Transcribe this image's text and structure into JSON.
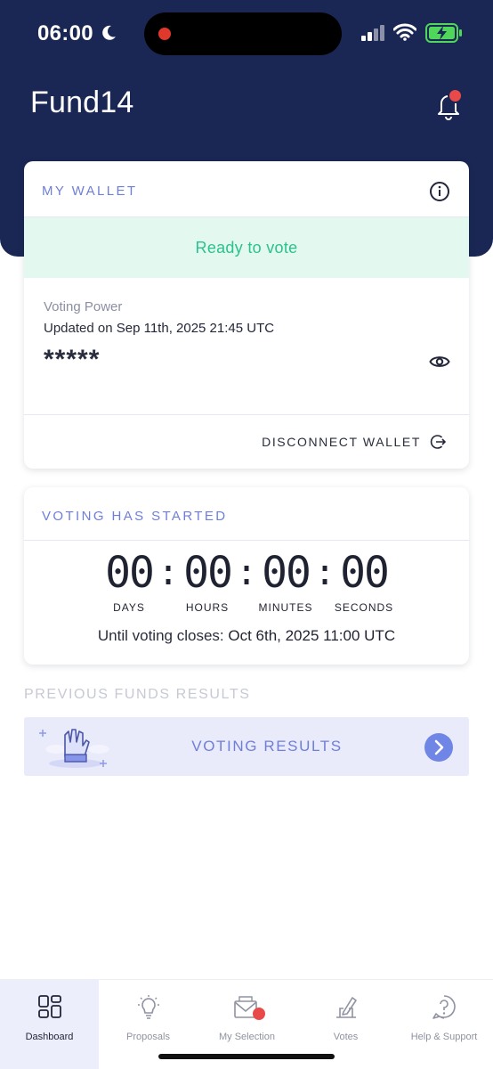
{
  "status_bar": {
    "time": "06:00",
    "icons": [
      "moon-icon",
      "signal-icon",
      "wifi-icon",
      "battery-charging-icon"
    ]
  },
  "header": {
    "title": "Fund14",
    "notification_icon": "bell-icon",
    "has_unread": true
  },
  "wallet_card": {
    "title": "MY WALLET",
    "status": "Ready to vote",
    "voting_power_label": "Voting Power",
    "updated_prefix": "Updated on",
    "updated_date": "Sep 11th, 2025 21:45 UTC",
    "voting_power_value": "*****",
    "disconnect_label": "DISCONNECT WALLET"
  },
  "voting_card": {
    "title": "VOTING HAS STARTED",
    "countdown": {
      "days": "00",
      "hours": "00",
      "minutes": "00",
      "seconds": "00",
      "days_label": "DAYS",
      "hours_label": "HOURS",
      "minutes_label": "MINUTES",
      "seconds_label": "SECONDS"
    },
    "until_prefix": "Until voting closes:",
    "until_date": "Oct 6th, 2025 11:00 UTC"
  },
  "previous_results": {
    "section_title": "PREVIOUS FUNDS RESULTS",
    "banner_label": "VOTING RESULTS"
  },
  "bottom_nav": {
    "items": [
      {
        "label": "Dashboard",
        "icon": "dashboard-icon",
        "active": true
      },
      {
        "label": "Proposals",
        "icon": "lightbulb-icon",
        "active": false
      },
      {
        "label": "My Selection",
        "icon": "mail-icon",
        "active": false
      },
      {
        "label": "Votes",
        "icon": "ballot-icon",
        "active": false
      },
      {
        "label": "Help & Support",
        "icon": "help-icon",
        "active": false
      }
    ]
  },
  "colors": {
    "header_bg": "#1a2754",
    "accent": "#6f7fd8",
    "ready_green": "#2cc190",
    "ready_bg": "#e3f8ef",
    "notification_red": "#e84a4a"
  }
}
